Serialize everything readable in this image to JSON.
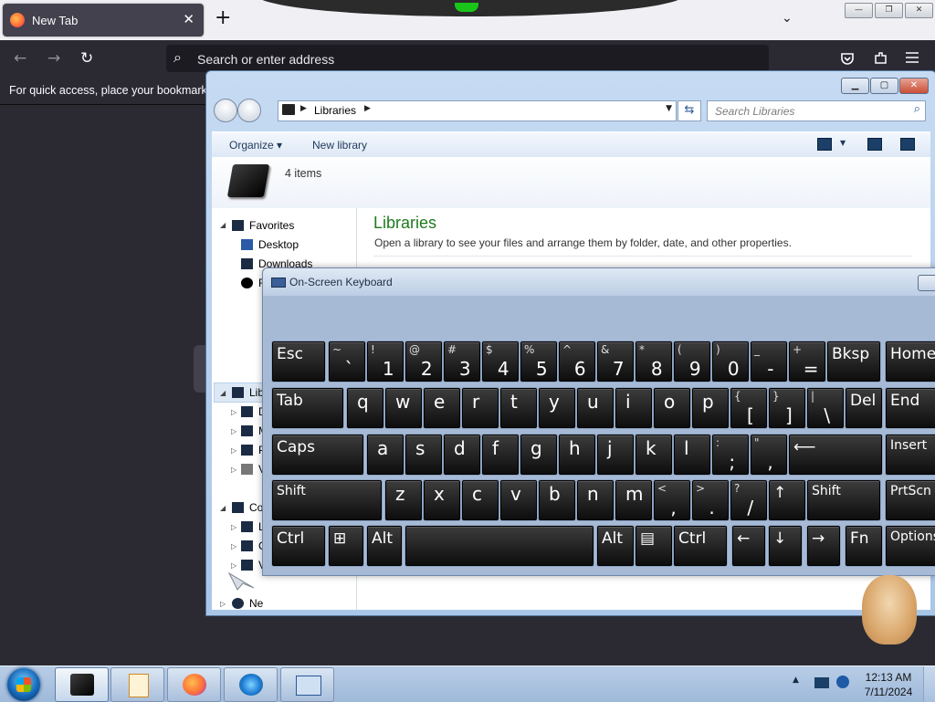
{
  "firefox": {
    "tab_title": "New Tab",
    "tab_close": "✕",
    "new_tab": "+",
    "list_tabs": "⌄",
    "back": "←",
    "forward": "→",
    "reload": "↻",
    "url_placeholder": "Search or enter address",
    "bookmarks_hint": "For quick access, place your bookmarks here on the bookmarks toolbar.",
    "pocket_icon": "pocket-icon",
    "extensions_icon": "extensions-icon",
    "menu_icon": "hamburger-menu-icon",
    "window_min": "—",
    "window_restore": "❐",
    "window_close": "✕"
  },
  "explorer": {
    "breadcrumb": "Libraries",
    "search_placeholder": "Search Libraries",
    "toolbar": {
      "organize": "Organize ▾",
      "new_library": "New library"
    },
    "item_count": "4 items",
    "heading": "Libraries",
    "subheading": "Open a library to see your files and arrange them by folder, date, and other properties.",
    "nav": {
      "favorites": "Favorites",
      "desktop": "Desktop",
      "downloads": "Downloads",
      "recent_partial": "R",
      "libraries_partial": "Lib",
      "lib_items": [
        "D",
        "M",
        "P",
        "V"
      ],
      "computer_partial": "Co",
      "computer_items": [
        "L",
        "C",
        "V"
      ],
      "network_partial": "Ne"
    }
  },
  "osk": {
    "title": "On-Screen Keyboard",
    "rows": [
      [
        {
          "top": "",
          "main": "Esc"
        },
        {
          "top": "~",
          "main": "`"
        },
        {
          "top": "!",
          "main": "1"
        },
        {
          "top": "@",
          "main": "2"
        },
        {
          "top": "#",
          "main": "3"
        },
        {
          "top": "$",
          "main": "4"
        },
        {
          "top": "%",
          "main": "5"
        },
        {
          "top": "^",
          "main": "6"
        },
        {
          "top": "&",
          "main": "7"
        },
        {
          "top": "*",
          "main": "8"
        },
        {
          "top": "(",
          "main": "9"
        },
        {
          "top": ")",
          "main": "0"
        },
        {
          "top": "_",
          "main": "-"
        },
        {
          "top": "+",
          "main": "="
        },
        {
          "top": "",
          "main": "Bksp"
        },
        {
          "top": "",
          "main": "Home"
        }
      ],
      [
        {
          "top": "",
          "main": "Tab"
        },
        {
          "top": "",
          "main": "q"
        },
        {
          "top": "",
          "main": "w"
        },
        {
          "top": "",
          "main": "e"
        },
        {
          "top": "",
          "main": "r"
        },
        {
          "top": "",
          "main": "t"
        },
        {
          "top": "",
          "main": "y"
        },
        {
          "top": "",
          "main": "u"
        },
        {
          "top": "",
          "main": "i"
        },
        {
          "top": "",
          "main": "o"
        },
        {
          "top": "",
          "main": "p"
        },
        {
          "top": "{",
          "main": "["
        },
        {
          "top": "}",
          "main": "]"
        },
        {
          "top": "|",
          "main": "\\"
        },
        {
          "top": "",
          "main": "Del"
        },
        {
          "top": "",
          "main": "End"
        }
      ],
      [
        {
          "top": "",
          "main": "Caps"
        },
        {
          "top": "",
          "main": "a"
        },
        {
          "top": "",
          "main": "s"
        },
        {
          "top": "",
          "main": "d"
        },
        {
          "top": "",
          "main": "f"
        },
        {
          "top": "",
          "main": "g"
        },
        {
          "top": "",
          "main": "h"
        },
        {
          "top": "",
          "main": "j"
        },
        {
          "top": "",
          "main": "k"
        },
        {
          "top": "",
          "main": "l"
        },
        {
          "top": ":",
          "main": ";"
        },
        {
          "top": "\"",
          "main": ","
        },
        {
          "top": "",
          "main": "⟵"
        },
        {
          "top": "",
          "main": "Insert"
        }
      ],
      [
        {
          "top": "",
          "main": "Shift"
        },
        {
          "top": "",
          "main": "z"
        },
        {
          "top": "",
          "main": "x"
        },
        {
          "top": "",
          "main": "c"
        },
        {
          "top": "",
          "main": "v"
        },
        {
          "top": "",
          "main": "b"
        },
        {
          "top": "",
          "main": "n"
        },
        {
          "top": "",
          "main": "m"
        },
        {
          "top": "<",
          "main": ","
        },
        {
          "top": ">",
          "main": "."
        },
        {
          "top": "?",
          "main": "/"
        },
        {
          "top": "",
          "main": "↑"
        },
        {
          "top": "",
          "main": "Shift"
        },
        {
          "top": "",
          "main": "PrtScn"
        }
      ],
      [
        {
          "top": "",
          "main": "Ctrl"
        },
        {
          "top": "",
          "main": "⊞"
        },
        {
          "top": "",
          "main": "Alt"
        },
        {
          "top": "",
          "main": ""
        },
        {
          "top": "",
          "main": "Alt"
        },
        {
          "top": "",
          "main": "▤"
        },
        {
          "top": "",
          "main": "Ctrl"
        },
        {
          "top": "",
          "main": "←"
        },
        {
          "top": "",
          "main": "↓"
        },
        {
          "top": "",
          "main": "→"
        },
        {
          "top": "",
          "main": "Fn"
        },
        {
          "top": "",
          "main": "Options"
        }
      ]
    ]
  },
  "taskbar": {
    "apps": [
      "libraries-explorer-icon",
      "media-player-icon",
      "firefox-icon",
      "download-manager-icon",
      "on-screen-keyboard-icon"
    ],
    "tray_expand": "▲",
    "time": "12:13 AM",
    "date": "7/11/2024"
  }
}
